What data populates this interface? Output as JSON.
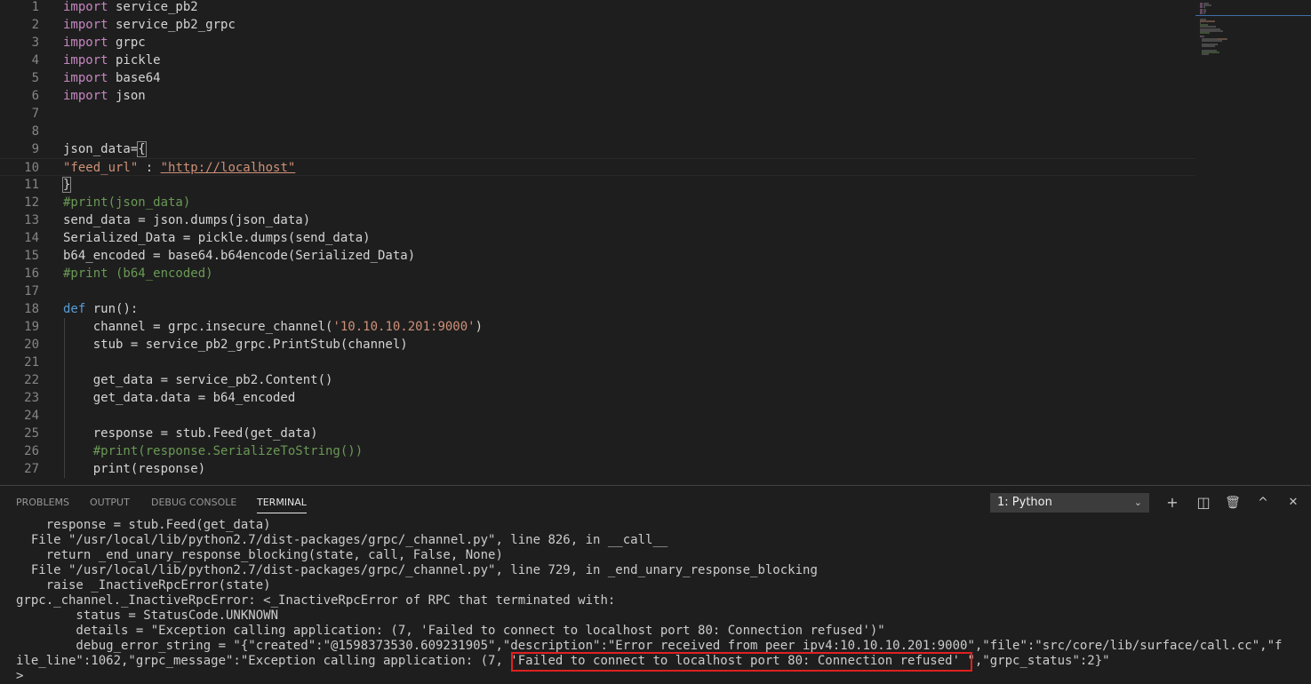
{
  "editor": {
    "lines": [
      {
        "num": "1",
        "tokens": [
          {
            "t": "import",
            "c": "kw"
          },
          {
            "t": " service_pb2",
            "c": "fn"
          }
        ]
      },
      {
        "num": "2",
        "tokens": [
          {
            "t": "import",
            "c": "kw"
          },
          {
            "t": " service_pb2_grpc",
            "c": "fn"
          }
        ]
      },
      {
        "num": "3",
        "tokens": [
          {
            "t": "import",
            "c": "kw"
          },
          {
            "t": " grpc",
            "c": "fn"
          }
        ]
      },
      {
        "num": "4",
        "tokens": [
          {
            "t": "import",
            "c": "kw"
          },
          {
            "t": " pickle",
            "c": "fn"
          }
        ]
      },
      {
        "num": "5",
        "tokens": [
          {
            "t": "import",
            "c": "kw"
          },
          {
            "t": " base64",
            "c": "fn"
          }
        ]
      },
      {
        "num": "6",
        "tokens": [
          {
            "t": "import",
            "c": "kw"
          },
          {
            "t": " json",
            "c": "fn"
          }
        ]
      },
      {
        "num": "7",
        "tokens": []
      },
      {
        "num": "8",
        "tokens": []
      },
      {
        "num": "9",
        "tokens": [
          {
            "t": "json_data=",
            "c": "fn"
          },
          {
            "t": "{",
            "c": "fn bracket"
          }
        ]
      },
      {
        "num": "10",
        "tokens": [
          {
            "t": "\"feed_url\"",
            "c": "str"
          },
          {
            "t": " : ",
            "c": "fn"
          },
          {
            "t": "\"http://localhost\"",
            "c": "str url-u"
          }
        ],
        "current": true
      },
      {
        "num": "11",
        "tokens": [
          {
            "t": "}",
            "c": "fn bracket"
          }
        ]
      },
      {
        "num": "12",
        "tokens": [
          {
            "t": "#print(json_data)",
            "c": "cmt"
          }
        ]
      },
      {
        "num": "13",
        "tokens": [
          {
            "t": "send_data = json.dumps(json_data)",
            "c": "fn"
          }
        ]
      },
      {
        "num": "14",
        "tokens": [
          {
            "t": "Serialized_Data = pickle.dumps(send_data)",
            "c": "fn"
          }
        ]
      },
      {
        "num": "15",
        "tokens": [
          {
            "t": "b64_encoded = base64.b64encode(Serialized_Data)",
            "c": "fn"
          }
        ]
      },
      {
        "num": "16",
        "tokens": [
          {
            "t": "#print (b64_encoded)",
            "c": "cmt"
          }
        ]
      },
      {
        "num": "17",
        "tokens": []
      },
      {
        "num": "18",
        "tokens": [
          {
            "t": "def",
            "c": "def"
          },
          {
            "t": " run():",
            "c": "fn"
          }
        ]
      },
      {
        "num": "19",
        "tokens": [
          {
            "t": "    channel = grpc.insecure_channel(",
            "c": "fn"
          },
          {
            "t": "'10.10.10.201:9000'",
            "c": "str"
          },
          {
            "t": ")",
            "c": "fn"
          }
        ]
      },
      {
        "num": "20",
        "tokens": [
          {
            "t": "    stub = service_pb2_grpc.PrintStub(channel)",
            "c": "fn"
          }
        ]
      },
      {
        "num": "21",
        "tokens": []
      },
      {
        "num": "22",
        "tokens": [
          {
            "t": "    get_data = service_pb2.Content()",
            "c": "fn"
          }
        ]
      },
      {
        "num": "23",
        "tokens": [
          {
            "t": "    get_data.data = b64_encoded",
            "c": "fn"
          }
        ]
      },
      {
        "num": "24",
        "tokens": []
      },
      {
        "num": "25",
        "tokens": [
          {
            "t": "    response = stub.Feed(get_data)",
            "c": "fn"
          }
        ]
      },
      {
        "num": "26",
        "tokens": [
          {
            "t": "    #print(response.SerializeToString())",
            "c": "cmt"
          }
        ]
      },
      {
        "num": "27",
        "tokens": [
          {
            "t": "    print(response)",
            "c": "fn"
          }
        ]
      }
    ]
  },
  "panel": {
    "tabs": [
      {
        "label": "PROBLEMS",
        "name": "tab-problems"
      },
      {
        "label": "OUTPUT",
        "name": "tab-output"
      },
      {
        "label": "DEBUG CONSOLE",
        "name": "tab-debug-console"
      },
      {
        "label": "TERMINAL",
        "name": "tab-terminal",
        "active": true
      }
    ],
    "terminal_select": "1: Python",
    "icons": {
      "add": "+",
      "split": "◫",
      "trash": "🗑",
      "maximize": "^",
      "close": "✕"
    },
    "output": [
      "    response = stub.Feed(get_data)",
      "  File \"/usr/local/lib/python2.7/dist-packages/grpc/_channel.py\", line 826, in __call__",
      "    return _end_unary_response_blocking(state, call, False, None)",
      "  File \"/usr/local/lib/python2.7/dist-packages/grpc/_channel.py\", line 729, in _end_unary_response_blocking",
      "    raise _InactiveRpcError(state)",
      "grpc._channel._InactiveRpcError: <_InactiveRpcError of RPC that terminated with:",
      "        status = StatusCode.UNKNOWN",
      "        details = \"Exception calling application: (7, 'Failed to connect to localhost port 80: Connection refused')\"",
      "        debug_error_string = \"{\"created\":\"@1598373530.609231905\",\"description\":\"Error received from peer ipv4:10.10.10.201:9000\",\"file\":\"src/core/lib/surface/call.cc\",\"f",
      "ile_line\":1062,\"grpc_message\":\"Exception calling application: (7, 'Failed to connect to localhost port 80: Connection refused' \",\"grpc_status\":2}\"",
      ">"
    ]
  }
}
